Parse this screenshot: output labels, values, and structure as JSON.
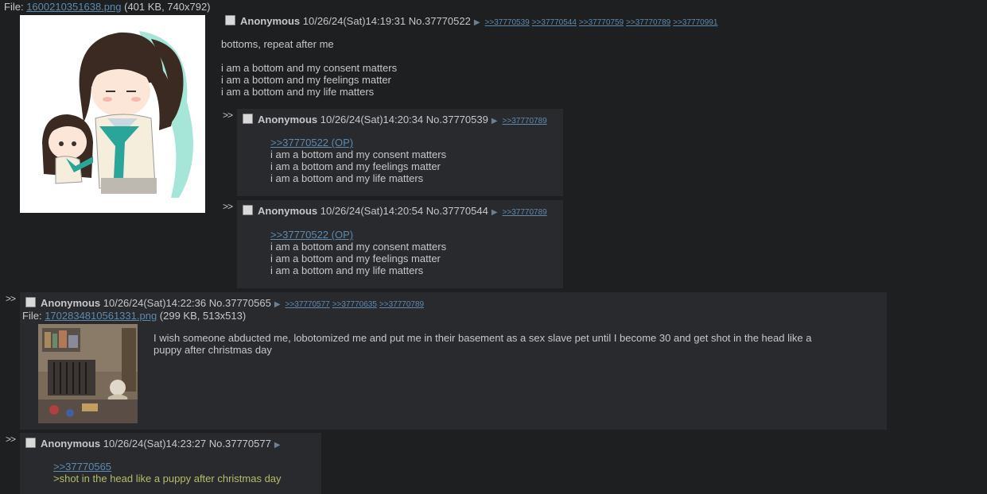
{
  "op": {
    "file_label": "File:",
    "file_name": "1600210351638.png",
    "file_meta": "(401 KB, 740x792)",
    "name": "Anonymous",
    "datetime": "10/26/24(Sat)14:19:31",
    "postno": "No.37770522",
    "backlinks": [
      ">>37770539",
      ">>37770544",
      ">>37770759",
      ">>37770789",
      ">>37770991"
    ],
    "lines": [
      "bottoms, repeat after me",
      "",
      "i am a bottom and my consent matters",
      "i am a bottom and my feelings matter",
      "i am a bottom and my life matters"
    ]
  },
  "replies": [
    {
      "name": "Anonymous",
      "datetime": "10/26/24(Sat)14:20:34",
      "postno": "No.37770539",
      "backlinks": [
        ">>37770789"
      ],
      "quote": ">>37770522 (OP)",
      "lines": [
        "i am a bottom and my consent matters",
        "i am a bottom and my feelings matter",
        "i am a bottom and my life matters"
      ]
    },
    {
      "name": "Anonymous",
      "datetime": "10/26/24(Sat)14:20:54",
      "postno": "No.37770544",
      "backlinks": [
        ">>37770789"
      ],
      "quote": ">>37770522 (OP)",
      "lines": [
        "i am a bottom and my consent matters",
        "i am a bottom and my feelings matter",
        "i am a bottom and my life matters"
      ]
    },
    {
      "name": "Anonymous",
      "datetime": "10/26/24(Sat)14:22:36",
      "postno": "No.37770565",
      "backlinks": [
        ">>37770577",
        ">>37770635",
        ">>37770789"
      ],
      "file_label": "File:",
      "file_name": "1702834810561331.png",
      "file_meta": "(299 KB, 513x513)",
      "lines": [
        "I wish someone abducted me, lobotomized me and put me in their basement as a sex slave pet until I become 30 and get shot in the head like a",
        "puppy after christmas day"
      ]
    },
    {
      "name": "Anonymous",
      "datetime": "10/26/24(Sat)14:23:27",
      "postno": "No.37770577",
      "quote": ">>37770565",
      "greentext": ">shot in the head like a puppy after christmas day"
    }
  ],
  "ui": {
    "reply_arrows": ">>",
    "triangle": "▶"
  }
}
